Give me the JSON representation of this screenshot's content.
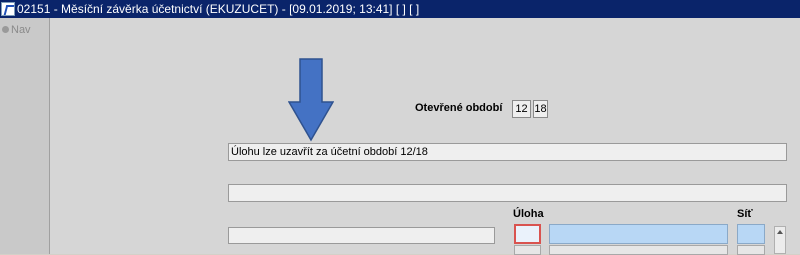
{
  "window": {
    "title": "02151 - Měsíční závěrka účetnictví (EKUZUCET) - [09.01.2019; 13:41]  [ ]  [ ]"
  },
  "nav": {
    "label": "Nav"
  },
  "form": {
    "open_period_label": "Otevřené období",
    "period_month": "12",
    "period_year": "18",
    "message": "Úlohu lze uzavřít za účetní období 12/18",
    "message2": "",
    "left_field": "",
    "col_task_label": "Úloha",
    "col_net_label": "Síť"
  },
  "colors": {
    "title_bar": "#0a246a",
    "arrow": "#4472c4",
    "selected_cell_border": "#d9534f",
    "light_blue_cell": "#b8d7f5"
  }
}
